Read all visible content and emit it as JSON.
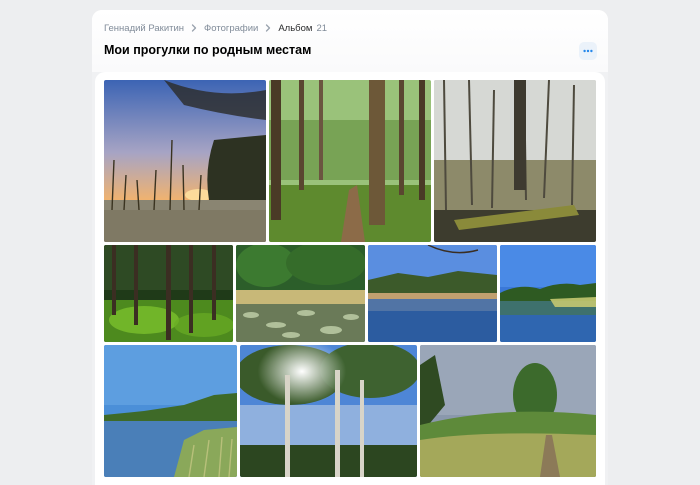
{
  "breadcrumb": {
    "owner": "Геннадий Ракитин",
    "section": "Фотографии",
    "current": "Альбом",
    "count": "21"
  },
  "album": {
    "title": "Мои прогулки по родным местам"
  },
  "icons": {
    "chevron": "chevron-right-icon",
    "more": "more-horizontal-icon"
  },
  "colors": {
    "accent": "#2688eb",
    "page_bg": "#edeef0"
  },
  "photos": [
    {
      "name": "photo-reeds-sunset"
    },
    {
      "name": "photo-forest-path"
    },
    {
      "name": "photo-swamp-forest"
    },
    {
      "name": "photo-pine-forest"
    },
    {
      "name": "photo-lily-pond"
    },
    {
      "name": "photo-lake-treeline"
    },
    {
      "name": "photo-lake-reflection"
    },
    {
      "name": "photo-lake-shore"
    },
    {
      "name": "photo-birches-sun"
    },
    {
      "name": "photo-meadow-path"
    }
  ]
}
